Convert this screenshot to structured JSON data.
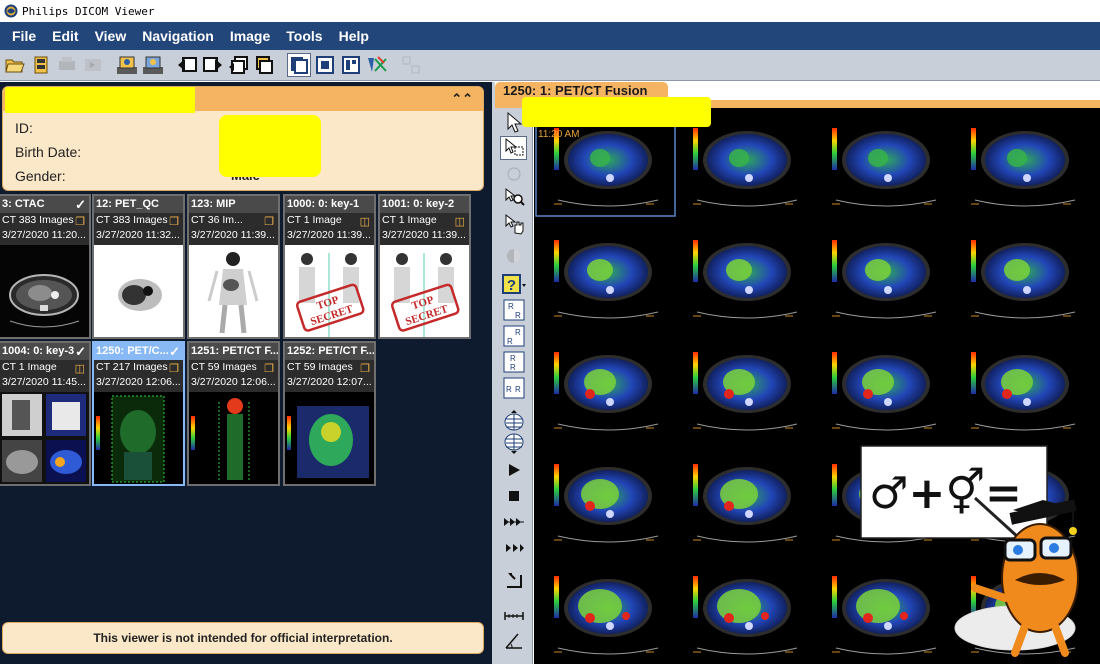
{
  "window": {
    "title": "Philips DICOM Viewer"
  },
  "menu": [
    "File",
    "Edit",
    "View",
    "Navigation",
    "Image",
    "Tools",
    "Help"
  ],
  "patient": {
    "id_label": "ID:",
    "birth_label": "Birth Date:",
    "gender_label": "Gender:",
    "gender_value": "Male"
  },
  "series": [
    {
      "title": "3: CTAC",
      "count": "CT 383 Images",
      "date": "3/27/2020 11:20...",
      "checked": true,
      "selected": false,
      "thumb": "ct-axial"
    },
    {
      "title": "12: PET_QC",
      "count": "CT 383 Images",
      "date": "3/27/2020 11:32...",
      "checked": false,
      "selected": false,
      "thumb": "pet-axial"
    },
    {
      "title": "123: MIP",
      "count": "CT 36 Im...",
      "date": "3/27/2020 11:39...",
      "checked": false,
      "selected": false,
      "thumb": "mip"
    },
    {
      "title": "1000: 0: key-1",
      "count": "CT 1 Image",
      "date": "3/27/2020 11:39...",
      "checked": false,
      "selected": false,
      "thumb": "key-stamp"
    },
    {
      "title": "1001: 0: key-2",
      "count": "CT 1 Image",
      "date": "3/27/2020 11:39...",
      "checked": false,
      "selected": false,
      "thumb": "key-stamp"
    },
    {
      "title": "1004: 0: key-3",
      "count": "CT 1 Image",
      "date": "3/27/2020 11:45...",
      "checked": true,
      "selected": false,
      "thumb": "collage"
    },
    {
      "title": "1250: PET/C...",
      "count": "CT 217 Images",
      "date": "3/27/2020 12:06...",
      "checked": true,
      "selected": true,
      "thumb": "fusion-coronal"
    },
    {
      "title": "1251: PET/CT F...",
      "count": "CT 59 Images",
      "date": "3/27/2020 12:06...",
      "checked": false,
      "selected": false,
      "thumb": "fusion-sagittal"
    },
    {
      "title": "1252: PET/CT F...",
      "count": "CT 59 Images",
      "date": "3/27/2020 12:07...",
      "checked": false,
      "selected": false,
      "thumb": "fusion-coronal2"
    }
  ],
  "stamp_text": [
    "TOP",
    "SECRET"
  ],
  "disclaimer": "This viewer is not intended for official interpretation.",
  "viewer": {
    "tab_title": "1250: 1: PET/CT Fusion",
    "timestamp": "11:20 AM"
  },
  "cartoon": {
    "sign_text": "♂+⚥="
  },
  "colors": {
    "menubar": "#22457a",
    "accent_orange": "#f5b462",
    "panel_bg": "#0e1a2e",
    "redaction": "#ffff00"
  }
}
